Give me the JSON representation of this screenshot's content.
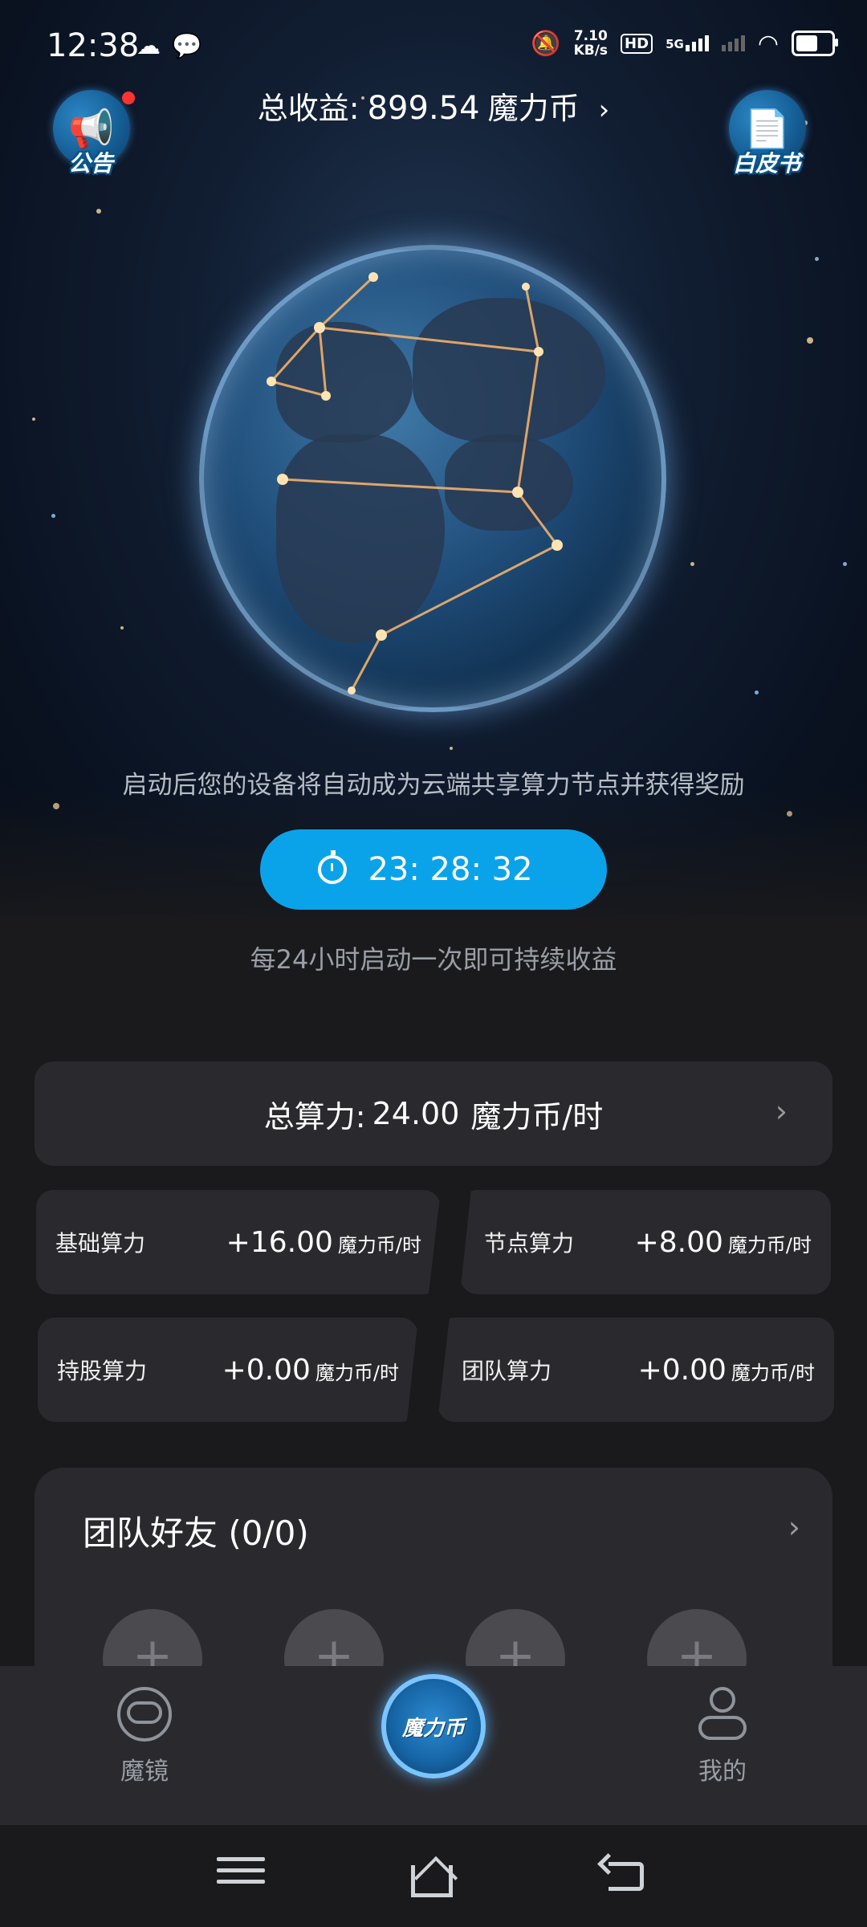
{
  "status_bar": {
    "time": "12:38",
    "left_icons": [
      "cloud-icon",
      "wechat-icon"
    ],
    "net_speed": "7.10",
    "net_unit": "KB/s",
    "hd_tag": "HD",
    "network": "5G"
  },
  "header": {
    "announcement_label": "公告",
    "whitepaper_label": "白皮书",
    "total_earnings_prefix": "总收益:",
    "total_earnings_value": "899.54",
    "total_earnings_unit": "魔力币"
  },
  "hero": {
    "description": "启动后您的设备将自动成为云端共享算力节点并获得奖励",
    "timer": "23: 28: 32",
    "hint": "每24小时启动一次即可持续收益"
  },
  "total_power": {
    "label": "总算力:",
    "value": "24.00",
    "unit": "魔力币/时"
  },
  "power_items": [
    {
      "label": "基础算力",
      "value": "+16.00",
      "unit": "魔力币/时"
    },
    {
      "label": "节点算力",
      "value": "+8.00",
      "unit": "魔力币/时"
    },
    {
      "label": "持股算力",
      "value": "+0.00",
      "unit": "魔力币/时"
    },
    {
      "label": "团队算力",
      "value": "+0.00",
      "unit": "魔力币/时"
    }
  ],
  "team": {
    "title": "团队好友 (0/0)",
    "slot_symbol": "+"
  },
  "bottom_nav": {
    "left_label": "魔镜",
    "center_label": "魔力币",
    "right_label": "我的"
  },
  "colors": {
    "accent": "#0aa3ea",
    "card": "#2a2a2e",
    "background": "#1a1a1c"
  }
}
